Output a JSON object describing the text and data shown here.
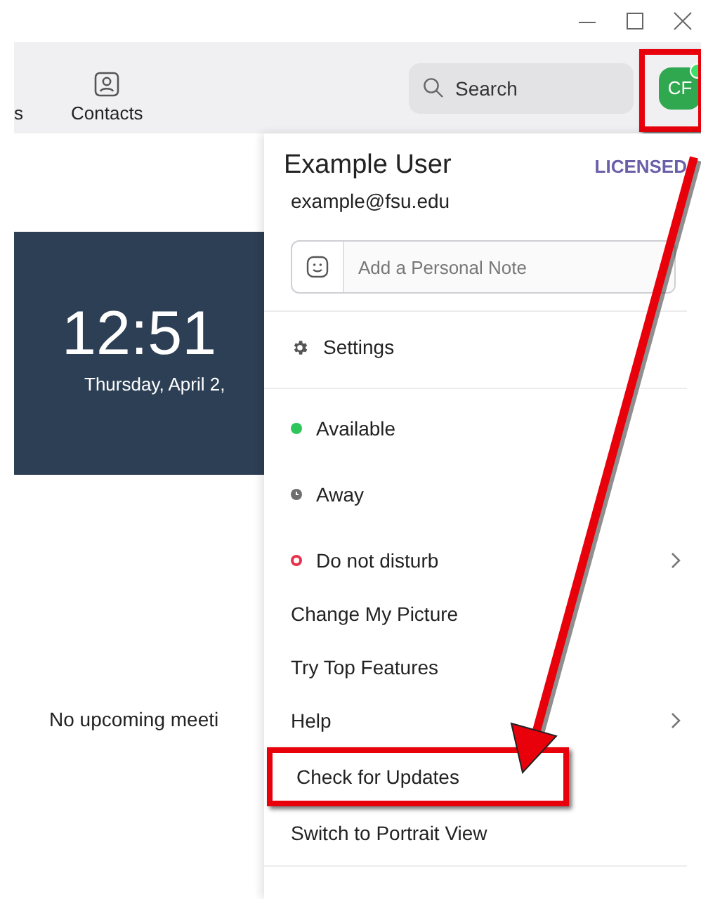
{
  "toolbar": {
    "tabs": [
      {
        "label": "s",
        "kind": "text"
      },
      {
        "label": "Contacts",
        "kind": "contacts"
      }
    ],
    "search": {
      "placeholder": "Search"
    },
    "avatar": {
      "initials": "CF",
      "online": true,
      "callout": true
    }
  },
  "home": {
    "clock": {
      "time": "12:51",
      "date": "Thursday, April 2,"
    },
    "meetings": "No upcoming meeti"
  },
  "menu": {
    "user": {
      "name": "Example User",
      "license": "LICENSED",
      "email": "example@fsu.edu"
    },
    "note": {
      "placeholder": "Add a Personal Note"
    },
    "items": [
      {
        "kind": "settings",
        "label": "Settings",
        "submenu": false,
        "highlighted": false,
        "divider_after": true
      },
      {
        "kind": "available",
        "label": "Available",
        "color": "#2ec55a",
        "submenu": false,
        "highlighted": false
      },
      {
        "kind": "away",
        "label": "Away",
        "color": "#6e6e6e",
        "submenu": false,
        "highlighted": false
      },
      {
        "kind": "busy",
        "label": "Do not disturb",
        "color": "#e8314a",
        "submenu": true,
        "highlighted": false
      },
      {
        "kind": "action",
        "label": "Change My Picture",
        "submenu": false,
        "highlighted": false
      },
      {
        "kind": "action",
        "label": "Try Top Features",
        "submenu": false,
        "highlighted": false
      },
      {
        "kind": "action",
        "label": "Help",
        "submenu": true,
        "highlighted": false
      },
      {
        "kind": "action",
        "label": "Check for Updates",
        "submenu": false,
        "highlighted": true
      },
      {
        "kind": "action",
        "label": "Switch to Portrait View",
        "submenu": false,
        "highlighted": false,
        "divider_after": true
      }
    ]
  },
  "annotation": {
    "arrow": true
  }
}
